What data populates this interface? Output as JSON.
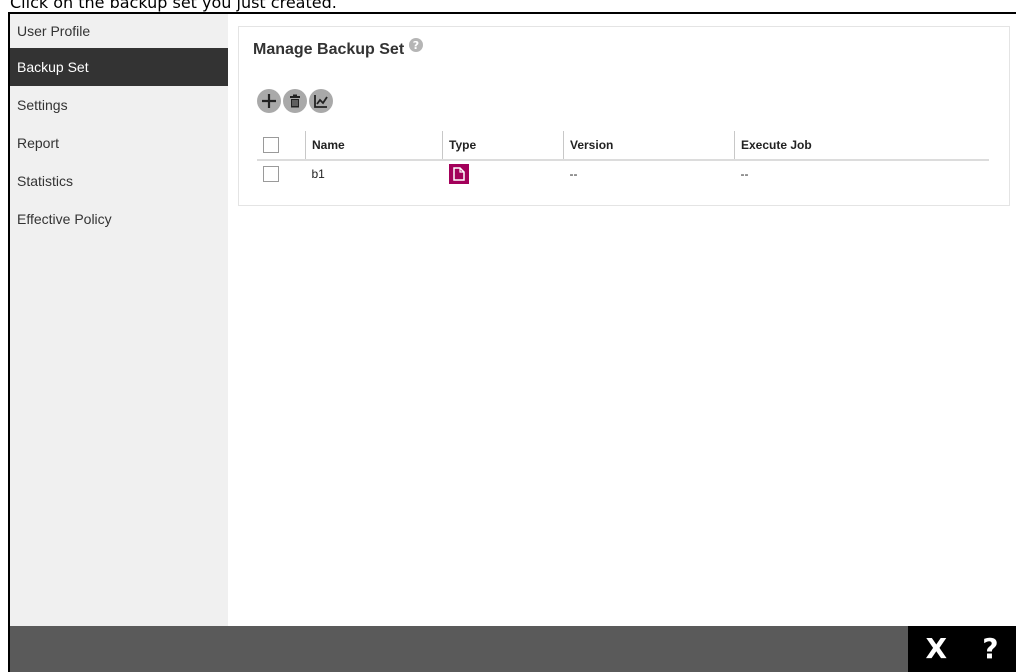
{
  "instruction": "Click on the backup set you just created.",
  "sidebar": {
    "items": [
      {
        "label": "User Profile",
        "active": false
      },
      {
        "label": "Backup Set",
        "active": true
      },
      {
        "label": "Settings",
        "active": false
      },
      {
        "label": "Report",
        "active": false
      },
      {
        "label": "Statistics",
        "active": false
      },
      {
        "label": "Effective Policy",
        "active": false
      }
    ]
  },
  "panel": {
    "title": "Manage Backup Set",
    "toolbar": {
      "icons": [
        "add-icon",
        "trash-icon",
        "chart-icon"
      ]
    },
    "table": {
      "columns": [
        "Name",
        "Type",
        "Version",
        "Execute Job"
      ],
      "rows": [
        {
          "name": "b1",
          "type_icon": "file-icon",
          "version": "--",
          "execute_job": "--"
        }
      ]
    }
  },
  "bottom_bar": {
    "close_label": "X",
    "help_label": "?"
  },
  "colors": {
    "sidebar_bg": "#f0f0f0",
    "sidebar_active_bg": "#333333",
    "type_badge": "#a3005a",
    "bottom_bar": "#5a5a5a",
    "bottom_right": "#000000",
    "tool_button": "#a9a9a9"
  }
}
